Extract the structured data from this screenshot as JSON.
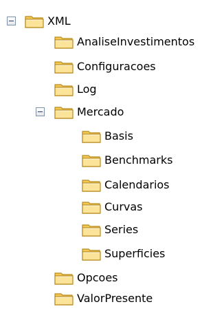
{
  "tree": {
    "root": {
      "label": "XML",
      "expanded": true
    },
    "level1": [
      {
        "label": "AnaliseInvestimentos"
      },
      {
        "label": "Configuracoes"
      },
      {
        "label": "Log"
      },
      {
        "label": "Mercado",
        "expanded": true
      },
      {
        "label": "Opcoes"
      },
      {
        "label": "ValorPresente"
      }
    ],
    "mercado_children": [
      {
        "label": "Basis"
      },
      {
        "label": "Benchmarks"
      },
      {
        "label": "Calendarios"
      },
      {
        "label": "Curvas"
      },
      {
        "label": "Series"
      },
      {
        "label": "Superficies"
      }
    ]
  },
  "colors": {
    "folder_fill": "#f7d57a",
    "folder_tab": "#f3c955",
    "folder_outline": "#b98a1e",
    "toggle_border": "#7d92a8"
  },
  "icons": {
    "folder": "folder-icon",
    "collapse": "collapse-minus-icon"
  }
}
